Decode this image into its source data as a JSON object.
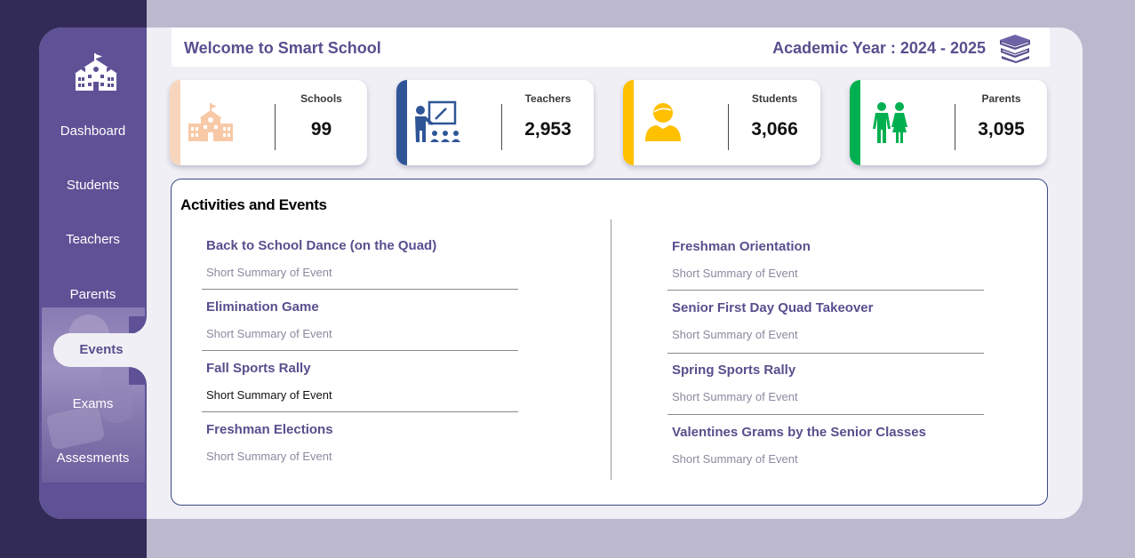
{
  "app": {
    "welcome": "Welcome to Smart School",
    "academic_year": "Academic Year : 2024 - 2025"
  },
  "sidebar": {
    "items": [
      {
        "label": "Dashboard"
      },
      {
        "label": "Students"
      },
      {
        "label": "Teachers"
      },
      {
        "label": "Parents"
      },
      {
        "label": "Events",
        "active": true
      },
      {
        "label": "Exams"
      },
      {
        "label": "Assesments"
      }
    ]
  },
  "cards": [
    {
      "label": "Schools",
      "value": "99",
      "icon": "school-icon",
      "accent": "#f8d5bd"
    },
    {
      "label": "Teachers",
      "value": "2,953",
      "icon": "teacher-icon",
      "accent": "#2f5597"
    },
    {
      "label": "Students",
      "value": "3,066",
      "icon": "student-icon",
      "accent": "#ffc000"
    },
    {
      "label": "Parents",
      "value": "3,095",
      "icon": "parents-icon",
      "accent": "#00b050"
    }
  ],
  "events": {
    "title": "Activities and Events",
    "left": [
      {
        "title": "Back to School Dance (on the Quad)",
        "summary": "Short Summary of Event"
      },
      {
        "title": "Elimination Game",
        "summary": "Short Summary of Event"
      },
      {
        "title": "Fall Sports Rally",
        "summary": "Short Summary of Event"
      },
      {
        "title": "Freshman Elections",
        "summary": "Short Summary of Event"
      }
    ],
    "right": [
      {
        "title": "Freshman Orientation",
        "summary": "Short Summary of Event"
      },
      {
        "title": "Senior First Day Quad Takeover",
        "summary": "Short Summary of Event"
      },
      {
        "title": "Spring Sports Rally",
        "summary": "Short Summary of Event"
      },
      {
        "title": "Valentines Grams by the Senior Classes",
        "summary": "Short Summary of Event"
      }
    ]
  },
  "colors": {
    "primary": "#5f5196",
    "dark": "#322b57",
    "text_accent": "#5a4e8e"
  }
}
